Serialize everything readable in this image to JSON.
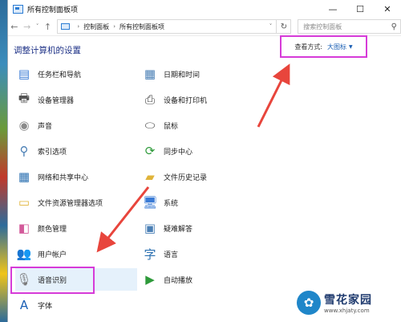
{
  "window": {
    "title": "所有控制面板项",
    "controls": {
      "minimize": "—",
      "maximize": "☐",
      "close": "✕"
    }
  },
  "nav": {
    "back": "←",
    "forward": "→",
    "down": "˅",
    "up": "↑"
  },
  "address": {
    "crumbs": [
      "控制面板",
      "所有控制面板项"
    ],
    "separator": "›",
    "dropdown": "˅",
    "refresh": "↻"
  },
  "search": {
    "placeholder": "搜索控制面板",
    "icon": "search-icon"
  },
  "heading": "调整计算机的设置",
  "view": {
    "label": "查看方式:",
    "value": "大图标",
    "caret": "▼"
  },
  "left_items": [
    {
      "label": "任务栏和导航",
      "icon": "taskbar-icon",
      "glyph": "▤",
      "color": "#3a7bd5"
    },
    {
      "label": "设备管理器",
      "icon": "device-manager-icon",
      "glyph": "🖶",
      "color": "#555555"
    },
    {
      "label": "声音",
      "icon": "speaker-icon",
      "glyph": "◉",
      "color": "#8a8a8a"
    },
    {
      "label": "索引选项",
      "icon": "index-search-icon",
      "glyph": "⚲",
      "color": "#4a7fb5"
    },
    {
      "label": "网络和共享中心",
      "icon": "network-icon",
      "glyph": "▦",
      "color": "#2a6fb0"
    },
    {
      "label": "文件资源管理器选项",
      "icon": "folder-options-icon",
      "glyph": "▭",
      "color": "#e0b43a"
    },
    {
      "label": "颜色管理",
      "icon": "color-management-icon",
      "glyph": "◧",
      "color": "#d35a9a"
    },
    {
      "label": "用户帐户",
      "icon": "user-accounts-icon",
      "glyph": "👥",
      "color": "#3a6aa0"
    },
    {
      "label": "语音识别",
      "icon": "microphone-icon",
      "glyph": "🎙",
      "color": "#7a7a7a"
    },
    {
      "label": "字体",
      "icon": "fonts-icon",
      "glyph": "A",
      "color": "#1a5fb4"
    }
  ],
  "right_items": [
    {
      "label": "日期和时间",
      "icon": "calendar-clock-icon",
      "glyph": "▦",
      "color": "#4a7fb5"
    },
    {
      "label": "设备和打印机",
      "icon": "printer-icon",
      "glyph": "⎙",
      "color": "#444444"
    },
    {
      "label": "鼠标",
      "icon": "mouse-icon",
      "glyph": "⬭",
      "color": "#555555"
    },
    {
      "label": "同步中心",
      "icon": "sync-icon",
      "glyph": "⟳",
      "color": "#2e9a3a"
    },
    {
      "label": "文件历史记录",
      "icon": "file-history-icon",
      "glyph": "▰",
      "color": "#e0b43a"
    },
    {
      "label": "系统",
      "icon": "system-icon",
      "glyph": "🖥",
      "color": "#3a7bd5"
    },
    {
      "label": "疑难解答",
      "icon": "troubleshoot-icon",
      "glyph": "▣",
      "color": "#4a7fb5"
    },
    {
      "label": "语言",
      "icon": "language-icon",
      "glyph": "字",
      "color": "#2a6fb0"
    },
    {
      "label": "自动播放",
      "icon": "autoplay-icon",
      "glyph": "▶",
      "color": "#2e9a3a"
    }
  ],
  "watermark": {
    "logo": "✿",
    "name": "雪花家园",
    "url": "www.xhjaty.com"
  },
  "colors": {
    "highlight": "#d63bd8",
    "arrow": "#e8453c",
    "heading": "#1e3287",
    "link": "#1a5fb4"
  }
}
